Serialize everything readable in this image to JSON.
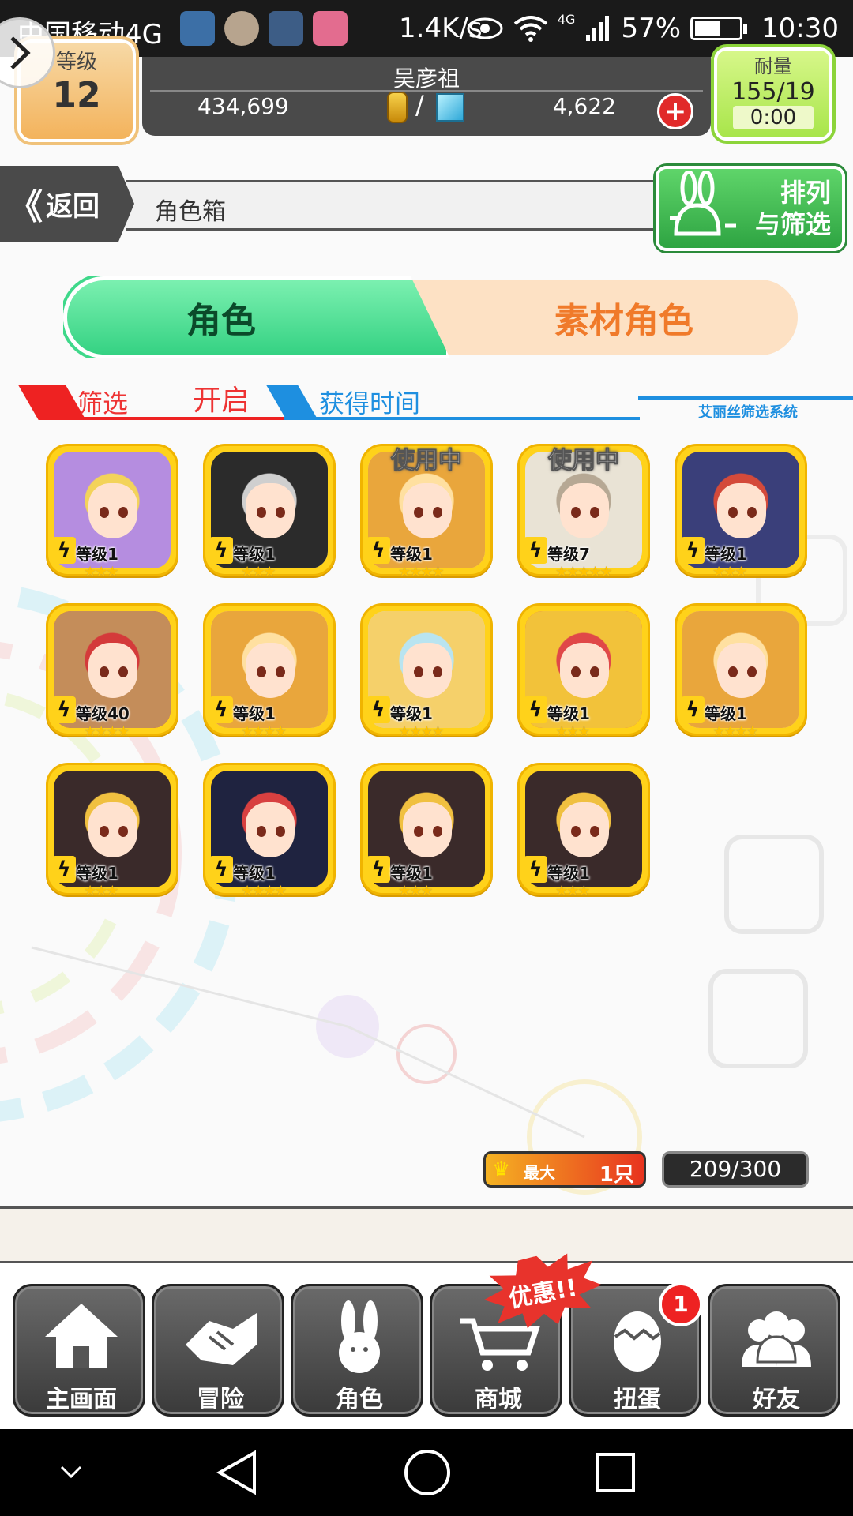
{
  "status_bar": {
    "carrier": "中国移动4G",
    "net_speed": "1.4K/s",
    "network_type": "4G",
    "battery": "57%",
    "time": "10:30"
  },
  "player": {
    "level_label": "等级",
    "level": "12",
    "name": "吴彦祖",
    "coins": "434,699",
    "separator": "/",
    "gems": "4,622",
    "stamina_label": "耐量",
    "stamina": "155/19",
    "stamina_timer": "0:00"
  },
  "subheader": {
    "back_label": "返回",
    "page_title": "角色箱",
    "sort_filter_line1": "排列",
    "sort_filter_line2": "与筛选"
  },
  "tabs": {
    "characters": "角色",
    "materials": "素材角色"
  },
  "filter": {
    "filter_label": "筛选",
    "filter_value": "开启",
    "sort_label": "获得时间",
    "system_label": "艾丽丝筛选系统"
  },
  "characters": [
    {
      "level": "等级1",
      "stars": "★★★",
      "in_use": "",
      "palette": "purple"
    },
    {
      "level": "等级1",
      "stars": "★★★",
      "in_use": "",
      "palette": "black"
    },
    {
      "level": "等级1",
      "stars": "★★★★",
      "in_use": "使用中",
      "palette": "gold"
    },
    {
      "level": "等级7",
      "stars": "★★★★★",
      "in_use": "使用中",
      "palette": "silver"
    },
    {
      "level": "等级1",
      "stars": "★★★",
      "in_use": "",
      "palette": "navy"
    },
    {
      "level": "等级40",
      "stars": "★★★★",
      "in_use": "",
      "palette": "brown"
    },
    {
      "level": "等级1",
      "stars": "★★★★",
      "in_use": "",
      "palette": "gold"
    },
    {
      "level": "等级1",
      "stars": "★★★★",
      "in_use": "",
      "palette": "blonde"
    },
    {
      "level": "等级1",
      "stars": "★★★",
      "in_use": "",
      "palette": "yellow"
    },
    {
      "level": "等级1",
      "stars": "★★★★",
      "in_use": "",
      "palette": "gold"
    },
    {
      "level": "等级1",
      "stars": "★★★",
      "in_use": "",
      "palette": "witch"
    },
    {
      "level": "等级1",
      "stars": "★★★★",
      "in_use": "",
      "palette": "dark"
    },
    {
      "level": "等级1",
      "stars": "★★★",
      "in_use": "",
      "palette": "witch"
    },
    {
      "level": "等级1",
      "stars": "★★★",
      "in_use": "",
      "palette": "witch"
    }
  ],
  "counters": {
    "max_label": "最大",
    "max_value": "1只",
    "capacity": "209/300"
  },
  "promo": {
    "label": "优惠!!"
  },
  "bottom_nav": [
    {
      "label": "主画面",
      "icon": "home-icon"
    },
    {
      "label": "冒险",
      "icon": "handshake-icon"
    },
    {
      "label": "角色",
      "icon": "rabbit-icon"
    },
    {
      "label": "商城",
      "icon": "cart-icon"
    },
    {
      "label": "扭蛋",
      "icon": "egg-icon",
      "badge": "1"
    },
    {
      "label": "好友",
      "icon": "friends-icon"
    }
  ],
  "colors": {
    "accent_green": "#35d283",
    "accent_orange": "#f07a2a",
    "filter_red": "#e22222",
    "sort_blue": "#1e8fe0",
    "card_gold": "#ffd21a"
  }
}
